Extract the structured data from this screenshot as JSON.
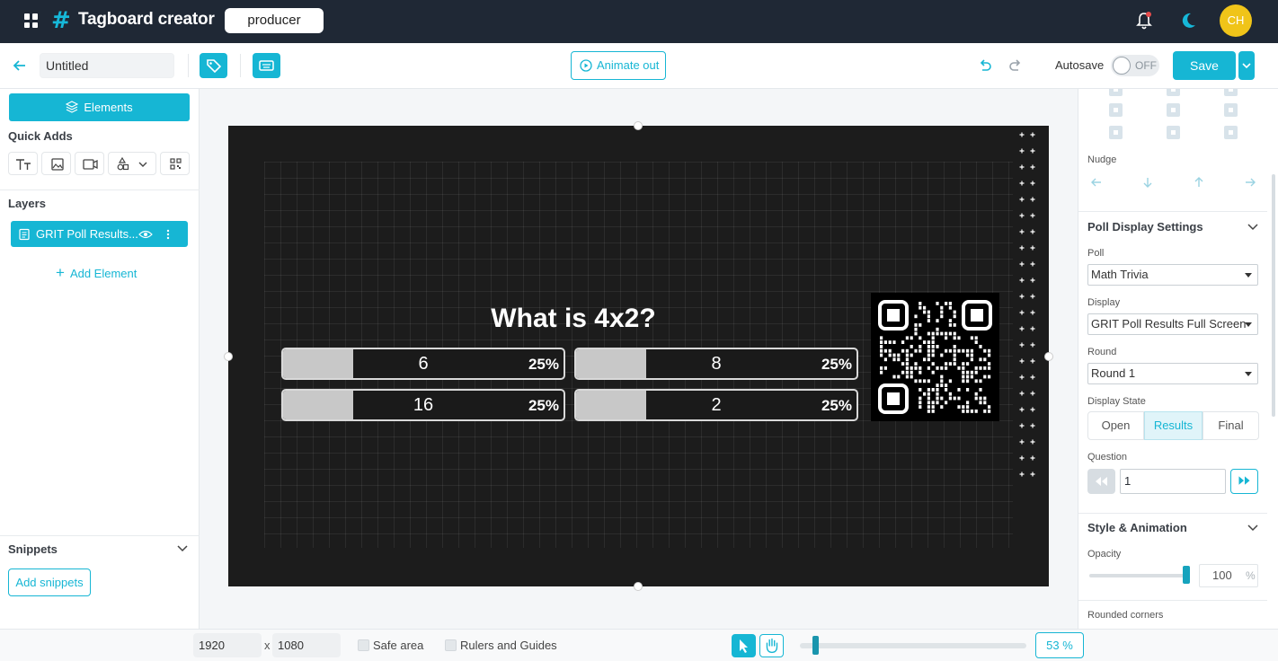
{
  "app": {
    "name": "Tagboard creator",
    "workspace": "producer",
    "avatar_initials": "CH",
    "accent": "#16b6d4"
  },
  "toolbar": {
    "title_value": "Untitled",
    "animate_label": "Animate out",
    "autosave_label": "Autosave",
    "autosave_state": "OFF",
    "save_label": "Save"
  },
  "left": {
    "elements_label": "Elements",
    "quick_adds_label": "Quick Adds",
    "layers_label": "Layers",
    "layer_name": "GRIT Poll Results...",
    "add_element_label": "Add Element",
    "snippets_label": "Snippets",
    "add_snippets_label": "Add snippets"
  },
  "stage": {
    "question": "What is 4x2?",
    "options": [
      {
        "label": "6",
        "percent": "25%",
        "fill": 0.25
      },
      {
        "label": "8",
        "percent": "25%",
        "fill": 0.25
      },
      {
        "label": "16",
        "percent": "25%",
        "fill": 0.25
      },
      {
        "label": "2",
        "percent": "25%",
        "fill": 0.25
      }
    ]
  },
  "right": {
    "nudge_label": "Nudge",
    "poll_settings_heading": "Poll Display Settings",
    "poll_label": "Poll",
    "poll_value": "Math Trivia",
    "display_label": "Display",
    "display_value": "GRIT Poll Results Full Screen",
    "round_label": "Round",
    "round_value": "Round 1",
    "display_state_label": "Display State",
    "states": [
      "Open",
      "Results",
      "Final"
    ],
    "active_state": "Results",
    "question_label": "Question",
    "question_value": "1",
    "style_heading": "Style & Animation",
    "opacity_label": "Opacity",
    "opacity_value": "100",
    "opacity_unit": "%",
    "rounded_label": "Rounded corners"
  },
  "bottom": {
    "width": "1920",
    "x": "x",
    "height": "1080",
    "safe_area_label": "Safe area",
    "rulers_label": "Rulers and Guides",
    "zoom": "53 %"
  }
}
